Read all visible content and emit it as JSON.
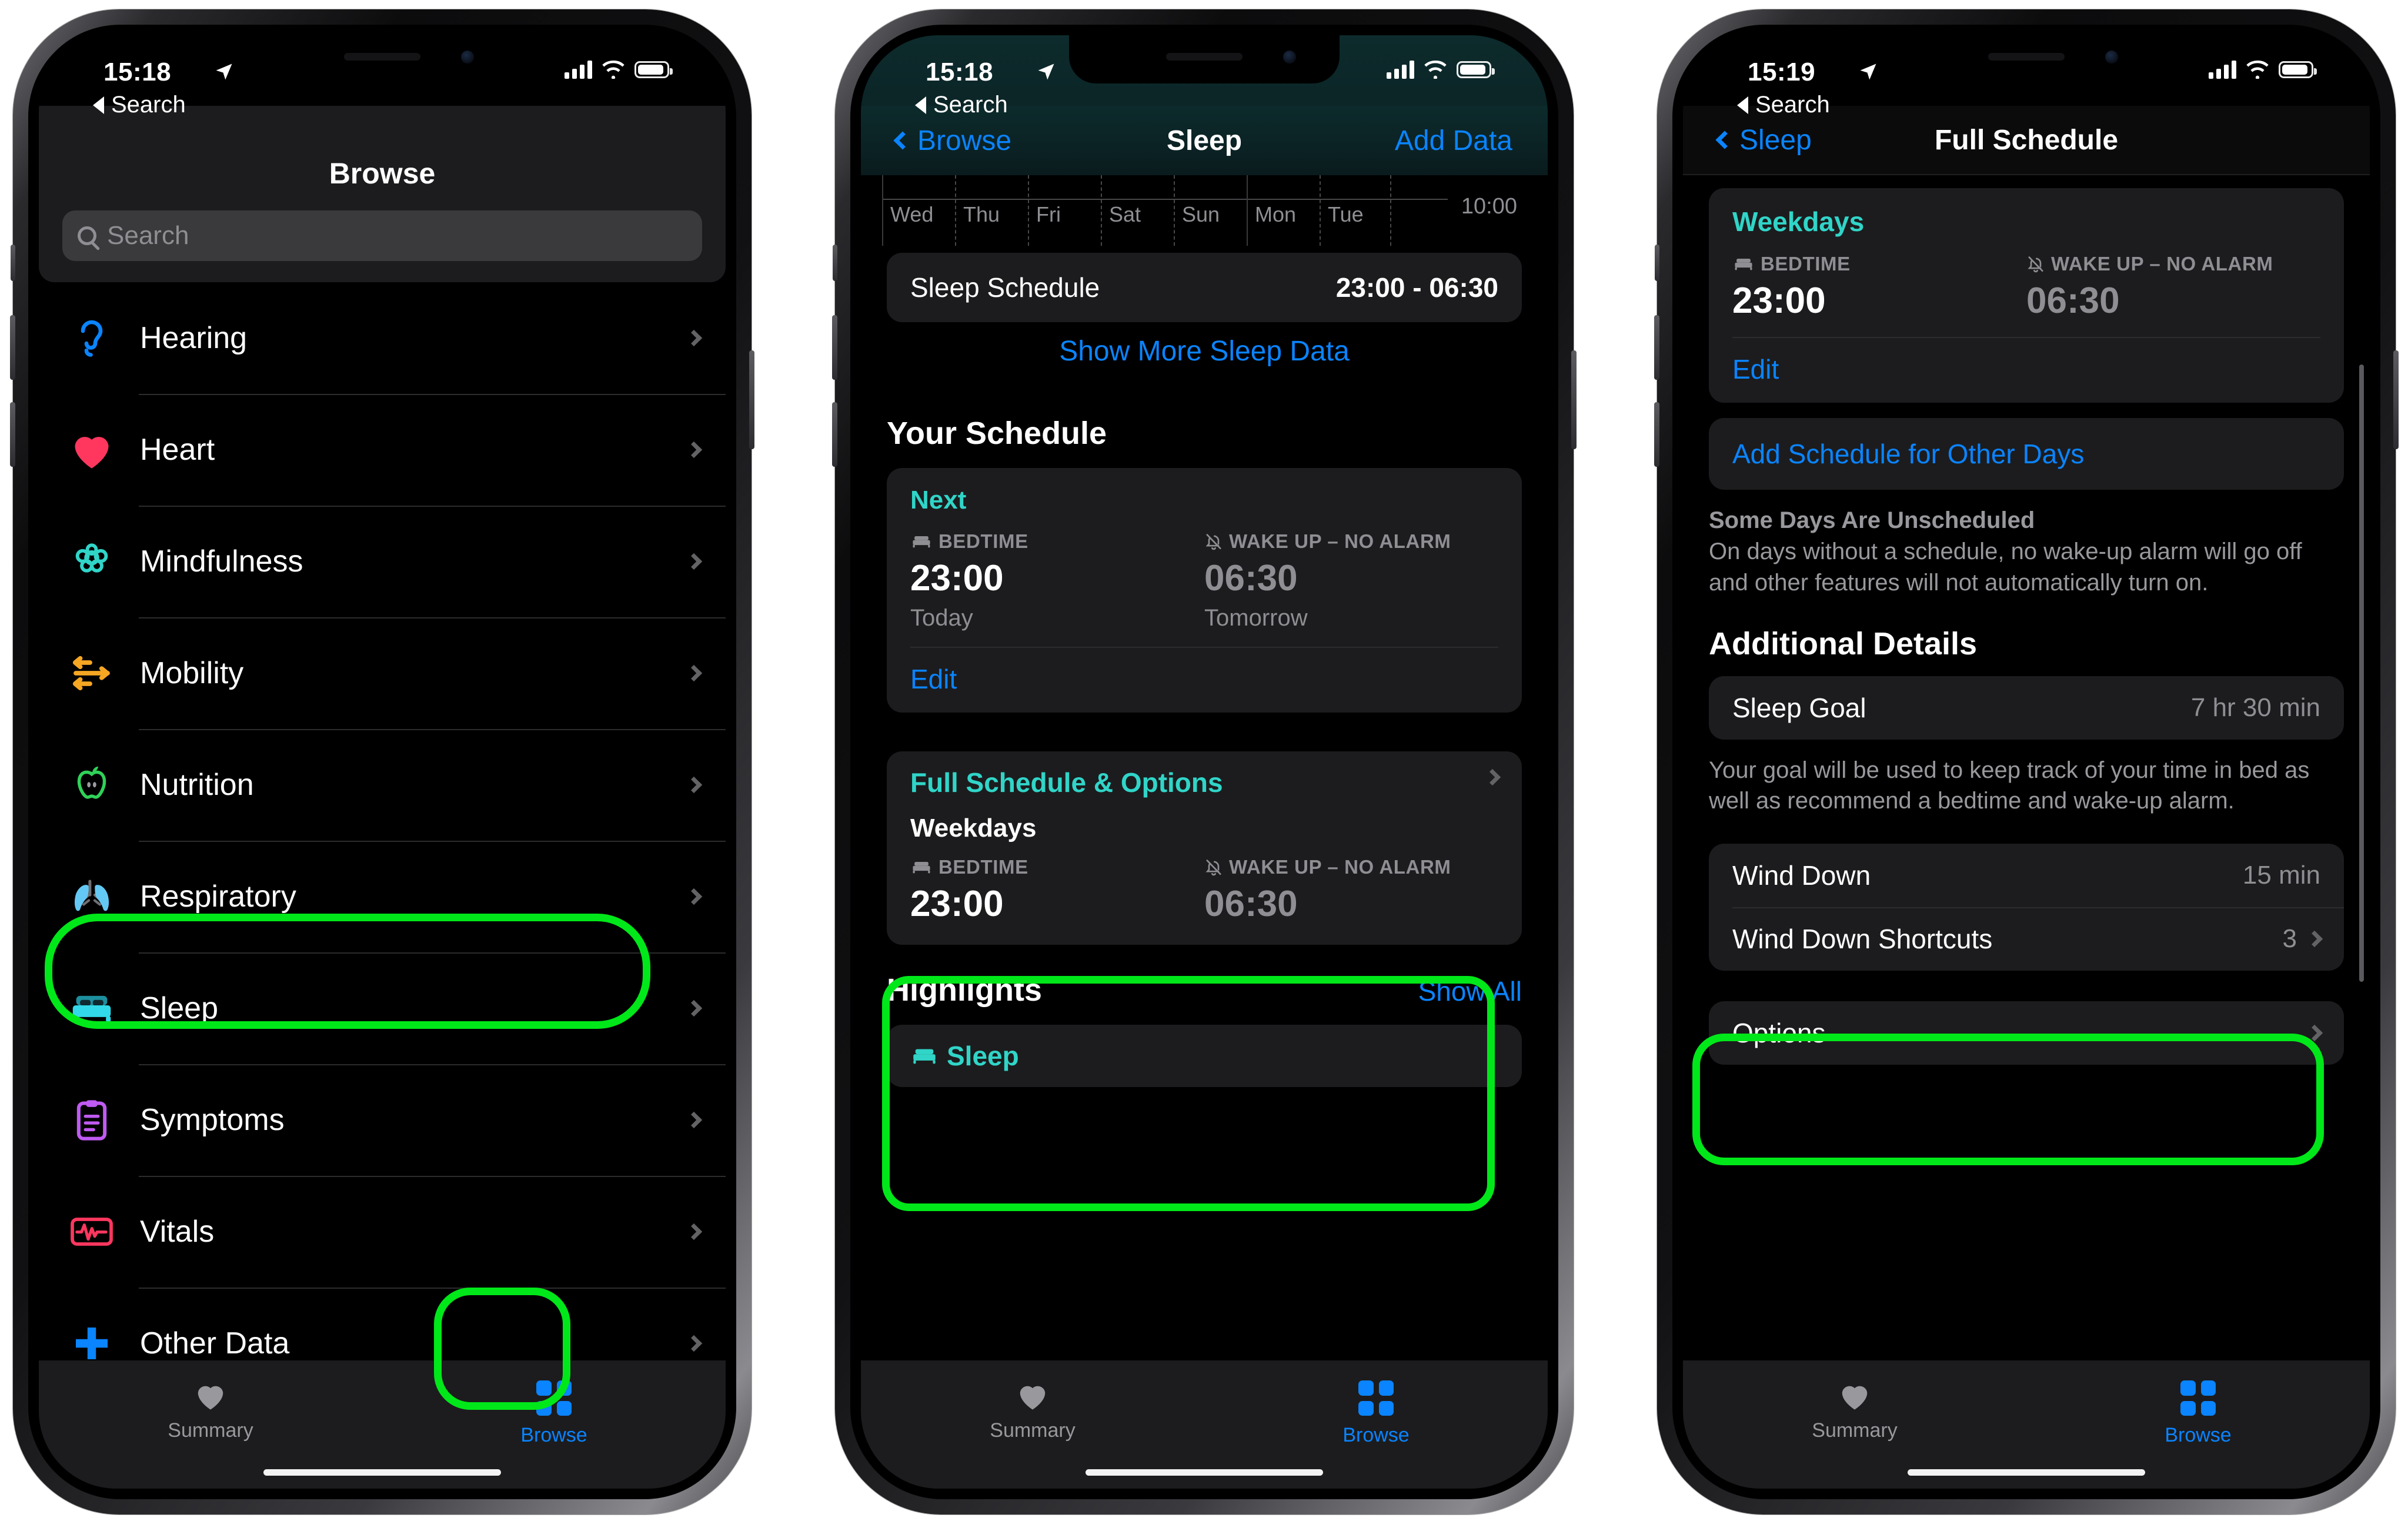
{
  "phone1": {
    "status": {
      "time": "15:18",
      "location_icon": "location-arrow-icon",
      "battery_icon": "battery-icon",
      "wifi_icon": "wifi-icon",
      "signal_icon": "cellular-bars-icon"
    },
    "back_app": {
      "label": "Search",
      "icon": "back-triangle-icon"
    },
    "title": "Browse",
    "search": {
      "placeholder": "Search",
      "icon": "search-icon"
    },
    "list": [
      {
        "label": "Hearing",
        "icon": "hearing-icon",
        "color": "#0a84ff"
      },
      {
        "label": "Heart",
        "icon": "heart-icon",
        "color": "#ff375f"
      },
      {
        "label": "Mindfulness",
        "icon": "mindfulness-icon",
        "color": "#30d5c8"
      },
      {
        "label": "Mobility",
        "icon": "mobility-icon",
        "color": "#f5a623"
      },
      {
        "label": "Nutrition",
        "icon": "apple-icon",
        "color": "#30d158"
      },
      {
        "label": "Respiratory",
        "icon": "lungs-icon",
        "color": "#64c8f5"
      },
      {
        "label": "Sleep",
        "icon": "bed-icon",
        "color": "#32d9e8",
        "highlighted": true
      },
      {
        "label": "Symptoms",
        "icon": "clipboard-icon",
        "color": "#bf5af2"
      },
      {
        "label": "Vitals",
        "icon": "waveform-icon",
        "color": "#ff375f"
      },
      {
        "label": "Other Data",
        "icon": "plus-icon",
        "color": "#0a84ff"
      }
    ],
    "tabs": [
      {
        "label": "Summary",
        "icon": "heart-icon",
        "active": false
      },
      {
        "label": "Browse",
        "icon": "grid-icon",
        "active": true,
        "highlighted": true
      }
    ]
  },
  "phone2": {
    "status": {
      "time": "15:18"
    },
    "back_app": {
      "label": "Search"
    },
    "nav": {
      "back": "Browse",
      "title": "Sleep",
      "action": "Add Data"
    },
    "chart": {
      "days": [
        "Wed",
        "Thu",
        "Fri",
        "Sat",
        "Sun",
        "Mon",
        "Tue"
      ],
      "axis_label": "10:00"
    },
    "sleep_schedule_row": {
      "label": "Sleep Schedule",
      "value": "23:00 - 06:30"
    },
    "show_more": "Show More Sleep Data",
    "your_schedule": {
      "heading": "Your Schedule",
      "next_label": "Next",
      "bedtime_label": "BEDTIME",
      "wake_label": "WAKE UP – NO ALARM",
      "bedtime": "23:00",
      "wake": "06:30",
      "bedtime_sub": "Today",
      "wake_sub": "Tomorrow",
      "edit": "Edit"
    },
    "full_schedule": {
      "title": "Full Schedule & Options",
      "weekdays": "Weekdays",
      "bedtime_label": "BEDTIME",
      "wake_label": "WAKE UP – NO ALARM",
      "bedtime": "23:00",
      "wake": "06:30",
      "highlighted": true
    },
    "highlights": {
      "heading": "Highlights",
      "show_all": "Show All",
      "card_title": "Sleep"
    },
    "tabs": [
      {
        "label": "Summary",
        "active": false
      },
      {
        "label": "Browse",
        "active": true
      }
    ]
  },
  "phone3": {
    "status": {
      "time": "15:19"
    },
    "back_app": {
      "label": "Search"
    },
    "nav": {
      "back": "Sleep",
      "title": "Full Schedule"
    },
    "weekdays_card": {
      "title": "Weekdays",
      "bedtime_label": "BEDTIME",
      "wake_label": "WAKE UP – NO ALARM",
      "bedtime": "23:00",
      "wake": "06:30",
      "edit": "Edit"
    },
    "add_schedule": "Add Schedule for Other Days",
    "unscheduled_note": {
      "title": "Some Days Are Unscheduled",
      "body": "On days without a schedule, no wake-up alarm will go off and other features will not automatically turn on."
    },
    "additional_details": {
      "heading": "Additional Details",
      "sleep_goal_label": "Sleep Goal",
      "sleep_goal_value": "7 hr 30 min",
      "goal_note": "Your goal will be used to keep track of your time in bed as well as recommend a bedtime and wake-up alarm."
    },
    "wind_down": {
      "label": "Wind Down",
      "value": "15 min",
      "shortcuts_label": "Wind Down Shortcuts",
      "shortcuts_value": "3",
      "highlighted": true
    },
    "options_row": "Options",
    "tabs": [
      {
        "label": "Summary",
        "active": false
      },
      {
        "label": "Browse",
        "active": true
      }
    ]
  },
  "annotation": {
    "color": "#00e819"
  }
}
